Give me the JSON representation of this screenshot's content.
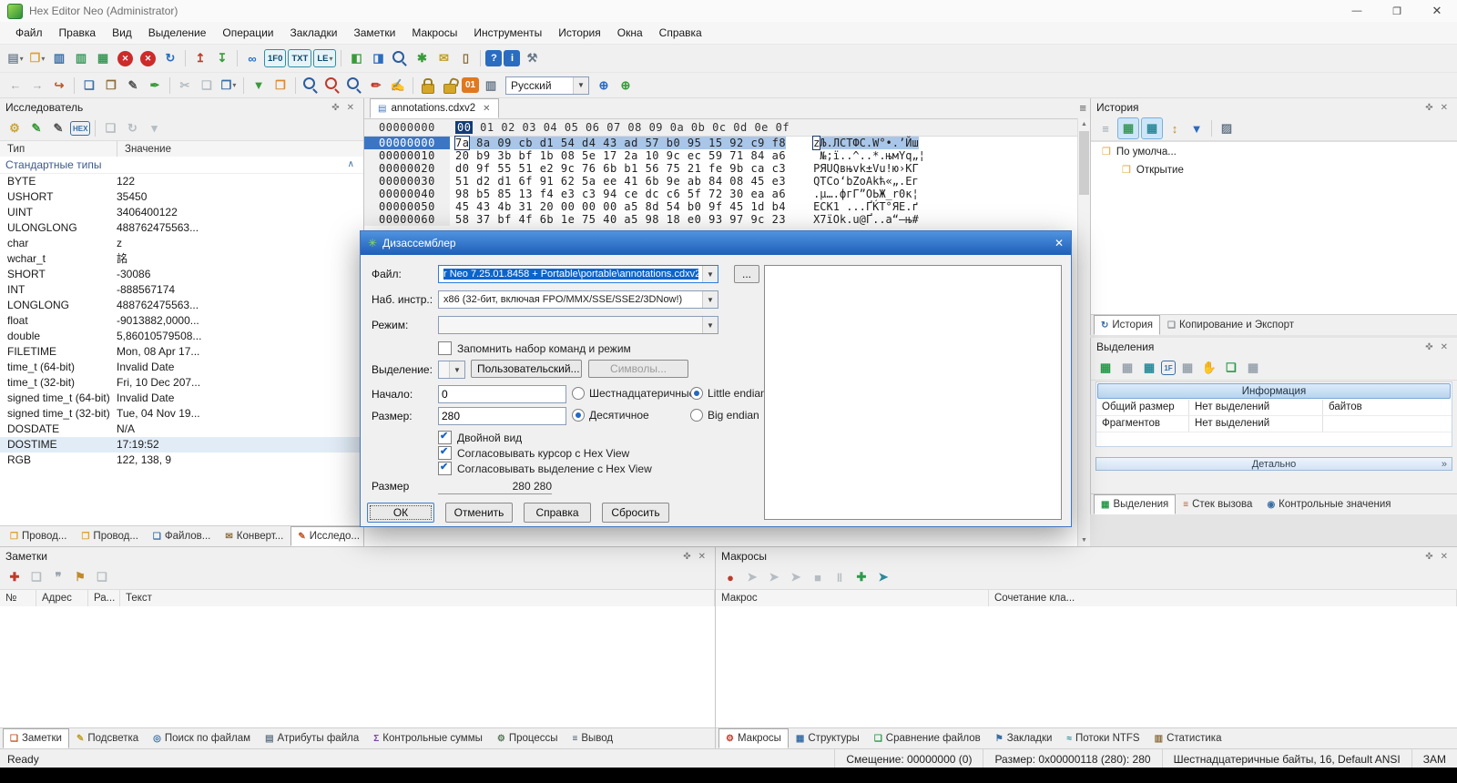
{
  "window": {
    "title": "Hex Editor Neo (Administrator)",
    "controls": {
      "minimize": "—",
      "maximize": "❐",
      "close": "✕"
    }
  },
  "icons": {
    "pin": "✜",
    "close": "✕",
    "hamburger": "≡",
    "collapse": "∧",
    "up_arrow": "▲",
    "down_arrow": "▼",
    "detail_chevron": "»"
  },
  "menubar": {
    "items": [
      "Файл",
      "Правка",
      "Вид",
      "Выделение",
      "Операции",
      "Закладки",
      "Заметки",
      "Макросы",
      "Инструменты",
      "История",
      "Окна",
      "Справка"
    ]
  },
  "toolbar_main": {
    "items": [
      {
        "name": "new-file-icon",
        "glyph": "▤",
        "c": "#7a8896",
        "caret": true
      },
      {
        "name": "open-file-icon",
        "glyph": "❒",
        "c": "#dca42e",
        "caret": true
      },
      {
        "name": "save-icon",
        "glyph": "▥",
        "c": "#3a6ea5"
      },
      {
        "name": "save-as-icon",
        "glyph": "▥",
        "c": "#3a9a5a"
      },
      {
        "name": "save-all-icon",
        "glyph": "▦",
        "c": "#3a9a5a"
      },
      {
        "name": "close-file-icon",
        "glyph": "✕",
        "cls": "ball"
      },
      {
        "name": "close-all-icon",
        "glyph": "✕",
        "cls": "ball"
      },
      {
        "name": "reload-icon",
        "glyph": "↻",
        "c": "#2a6cc0"
      },
      {
        "name": "toolbar-separator",
        "sep": true
      },
      {
        "name": "export-icon",
        "glyph": "↥",
        "c": "#c03a2a"
      },
      {
        "name": "import-icon",
        "glyph": "↧",
        "c": "#3a9a3a"
      },
      {
        "name": "toolbar-separator",
        "sep": true
      },
      {
        "name": "link-document-icon",
        "glyph": "∞",
        "c": "#2a6cc0"
      },
      {
        "name": "offset-display-toggle",
        "glyph": "1F0",
        "cls": "toggle"
      },
      {
        "name": "text-pane-toggle",
        "glyph": "TXT",
        "cls": "toggle"
      },
      {
        "name": "endianness-toggle",
        "glyph": "LE",
        "cls": "toggle",
        "caret": true
      },
      {
        "name": "toolbar-separator",
        "sep": true
      },
      {
        "name": "pattern-select-icon",
        "glyph": "◧",
        "c": "#3a9a3a"
      },
      {
        "name": "pattern-insert-icon",
        "glyph": "◨",
        "c": "#2a6cc0"
      },
      {
        "name": "find-in-file-icon",
        "cls": "magi"
      },
      {
        "name": "operations-icon",
        "glyph": "✱",
        "c": "#3a9a3a"
      },
      {
        "name": "feedback-icon",
        "glyph": "✉",
        "c": "#c0a02a"
      },
      {
        "name": "io-columns-icon",
        "glyph": "▯",
        "c": "#8a6d3b"
      },
      {
        "name": "toolbar-separator",
        "sep": true
      },
      {
        "name": "help-icon",
        "glyph": "?",
        "cls": "badge-blue"
      },
      {
        "name": "info-icon",
        "glyph": "i",
        "cls": "badge-blue"
      },
      {
        "name": "customize-icon",
        "glyph": "⚒",
        "c": "#667788"
      }
    ]
  },
  "toolbar_edit": {
    "language": "Русский",
    "items": [
      {
        "name": "nav-back-icon",
        "glyph": "←",
        "c": "#9aa4ae"
      },
      {
        "name": "nav-forward-icon",
        "glyph": "→",
        "c": "#9aa4ae"
      },
      {
        "name": "goto-offset-icon",
        "glyph": "↪",
        "c": "#c05a2a"
      },
      {
        "name": "toolbar-separator",
        "sep": true
      },
      {
        "name": "copy-icon",
        "glyph": "❏",
        "c": "#3a6ea5"
      },
      {
        "name": "paste-icon",
        "glyph": "❐",
        "c": "#8a6d3b"
      },
      {
        "name": "edit-pencil-icon",
        "glyph": "✎",
        "c": "#555555"
      },
      {
        "name": "fill-icon",
        "glyph": "✒",
        "c": "#3a9a3a"
      },
      {
        "name": "toolbar-separator",
        "sep": true
      },
      {
        "name": "cut-disabled-icon",
        "glyph": "✂",
        "c": "#b5bcc2"
      },
      {
        "name": "copy-disabled-icon",
        "glyph": "❏",
        "c": "#b5bcc2"
      },
      {
        "name": "paste-special-icon",
        "glyph": "❐",
        "c": "#3a6ea5",
        "caret": true
      },
      {
        "name": "toolbar-separator",
        "sep": true
      },
      {
        "name": "modify-data-icon",
        "glyph": "▼",
        "c": "#3a9a3a"
      },
      {
        "name": "structures-box-icon",
        "glyph": "❒",
        "c": "#dc8a2e"
      },
      {
        "name": "toolbar-separator",
        "sep": true
      },
      {
        "name": "zoom-in-icon",
        "cls": "magi"
      },
      {
        "name": "find-replace-icon",
        "cls": "magi magi-red"
      },
      {
        "name": "find-next-icon",
        "cls": "magi"
      },
      {
        "name": "annotate-icon",
        "glyph": "✏",
        "c": "#c03a2a"
      },
      {
        "name": "edit-document-icon",
        "glyph": "✍",
        "c": "#3a6ea5"
      },
      {
        "name": "toolbar-separator",
        "sep": true
      },
      {
        "name": "lock-icon",
        "cls": "locki"
      },
      {
        "name": "unlock-icon",
        "cls": "locki locki-open"
      },
      {
        "name": "binary-display-icon",
        "glyph": "01",
        "cls": "badge-orange"
      },
      {
        "name": "columns-layout-icon",
        "glyph": "▥",
        "c": "#667788"
      }
    ],
    "items2": [
      {
        "name": "encoding-globe-icon",
        "glyph": "⊕",
        "c": "#2a6cc0"
      },
      {
        "name": "codepage-edit-icon",
        "glyph": "⊕",
        "c": "#3a9a3a"
      }
    ]
  },
  "explorer": {
    "title": "Исследователь",
    "toolbar": [
      {
        "name": "type-config-icon",
        "glyph": "⚙",
        "c": "#caa53a"
      },
      {
        "name": "edit-value-icon",
        "glyph": "✎",
        "c": "#3a9a3a"
      },
      {
        "name": "write-value-icon",
        "glyph": "✎",
        "c": "#555555"
      },
      {
        "name": "hex-display-icon",
        "glyph": "HEX",
        "cls": "badge-blue-sm"
      },
      {
        "name": "toolbar-separator",
        "sep": true
      },
      {
        "name": "copy-value-icon",
        "glyph": "❏",
        "c": "#b5bcc2"
      },
      {
        "name": "refresh-values-icon",
        "glyph": "↻",
        "c": "#b5bcc2"
      },
      {
        "name": "explorer-options-icon",
        "glyph": "▾",
        "c": "#b5bcc2"
      }
    ],
    "columns": {
      "type": "Тип",
      "value": "Значение"
    },
    "group": "Стандартные типы",
    "rows": [
      {
        "type": "BYTE",
        "value": "122"
      },
      {
        "type": "USHORT",
        "value": "35450"
      },
      {
        "type": "UINT",
        "value": "3406400122"
      },
      {
        "type": "ULONGLONG",
        "value": "488762475563..."
      },
      {
        "type": "char",
        "value": "z"
      },
      {
        "type": "wchar_t",
        "value": "詺"
      },
      {
        "type": "SHORT",
        "value": "-30086"
      },
      {
        "type": "INT",
        "value": "-888567174"
      },
      {
        "type": "LONGLONG",
        "value": "488762475563..."
      },
      {
        "type": "float",
        "value": "-9013882,0000..."
      },
      {
        "type": "double",
        "value": "5,86010579508..."
      },
      {
        "type": "FILETIME",
        "value": "Mon, 08 Apr 17..."
      },
      {
        "type": "time_t (64-bit)",
        "value": "Invalid Date"
      },
      {
        "type": "time_t (32-bit)",
        "value": "Fri, 10 Dec 207..."
      },
      {
        "type": "signed time_t (64-bit)",
        "value": "Invalid Date"
      },
      {
        "type": "signed time_t (32-bit)",
        "value": "Tue, 04 Nov 19..."
      },
      {
        "type": "DOSDATE",
        "value": "N/A"
      },
      {
        "type": "DOSTIME",
        "value": "17:19:52",
        "selected": true
      },
      {
        "type": "RGB",
        "value": "122, 138, 9"
      }
    ],
    "tabs": [
      {
        "label": "Провод...",
        "glyph": "❒",
        "c": "#dca42e"
      },
      {
        "label": "Провод...",
        "glyph": "❒",
        "c": "#dca42e"
      },
      {
        "label": "Файлов...",
        "glyph": "❏",
        "c": "#3a6ea5"
      },
      {
        "label": "Конверт...",
        "glyph": "✉",
        "c": "#8a6d3b"
      },
      {
        "label": "Исследо...",
        "glyph": "✎",
        "c": "#c05a2a",
        "active": true
      }
    ]
  },
  "hexview": {
    "tab": {
      "label": "annotations.cdxv2",
      "close_glyph": "✕",
      "doc_glyph": "▤"
    },
    "header": {
      "offset": "00000000",
      "h1": "00",
      "h": " 01 02 03 04 05 06 07 08 09 0a 0b 0c 0d 0e 0f"
    },
    "rows": [
      {
        "offset": "00000000",
        "b1": "7a",
        "b": " 8a 09 cb d1 54 d4 43 ad 57 b0 95 15 92 c9 f8",
        "t1": "z",
        "t": "Љ.ЛСTФC.W°•.’Йш",
        "selected": true
      },
      {
        "offset": "00000010",
        "b1": "20",
        "b": " b9 3b bf 1b 08 5e 17 2a 10 9c ec 59 71 84 a6",
        "t1": " ",
        "t": "№;ї..^..*.њмYq„¦"
      },
      {
        "offset": "00000020",
        "b1": "d0",
        "b": " 9f 55 51 e2 9c 76 6b b1 56 75 21 fe 9b ca c3",
        "t1": "Р",
        "t": "ЯUQвњvk±Vu!ю›КГ"
      },
      {
        "offset": "00000030",
        "b1": "51",
        "b": " d2 d1 6f 91 62 5a ee 41 6b 9e ab 84 08 45 e3",
        "t1": "Q",
        "t": "ТСo‘bZоAkћ«„.Eг"
      },
      {
        "offset": "00000040",
        "b1": "98",
        "b": " b5 85 13 f4 e3 c3 94 ce dc c6 5f 72 30 ea a6",
        "t1": ".",
        "t": "µ….фгГ”ОЬЖ_r0к¦"
      },
      {
        "offset": "00000050",
        "b1": "45",
        "b": " 43 4b 31 20 00 00 00 a5 8d 54 b0 9f 45 1d b4",
        "t1": "E",
        "t": "CK1 ...ҐЌT°ЯE.ґ"
      },
      {
        "offset": "00000060",
        "b1": "58",
        "b": " 37 bf 4f 6b 1e 75 40 a5 98 18 e0 93 97 9c 23",
        "t1": "X",
        "t": "7їOk.u@Ґ..а“—њ#"
      }
    ]
  },
  "dialog": {
    "title": "Дизассемблер",
    "title_icon": "✳",
    "close_glyph": "✕",
    "file_label": "Файл:",
    "file_value": "r Neo 7.25.01.8458 + Portable\\portable\\annotations.cdxv2",
    "browse_label": "...",
    "instr_label": "Наб. инстр.:",
    "instr_value": "x86 (32-бит, включая FPO/MMX/SSE/SSE2/3DNow!)",
    "mode_label": "Режим:",
    "remember_label": "Запомнить набор команд и режим",
    "remember": false,
    "selection_label": "Выделение:",
    "custom_button": "Пользовательский...",
    "symbols_button": "Символы...",
    "start_label": "Начало:",
    "start_value": "0",
    "size_label": "Размер:",
    "size_value": "280",
    "radio_hex": "Шестнадцатеричные",
    "radio_dec": "Десятичное",
    "radio_le": "Little endian",
    "radio_be": "Big endian",
    "start_base": "dec",
    "endianness": "little",
    "check_double": "Двойной вид",
    "check_cursor": "Согласовывать курсор с Hex View",
    "check_selection": "Согласовывать выделение с Hex View",
    "double_view": true,
    "sync_cursor": true,
    "sync_selection": true,
    "size2_label": "Размер",
    "size2_value": "280 280",
    "ok": "ОК",
    "cancel": "Отменить",
    "help": "Справка",
    "reset": "Сбросить"
  },
  "history": {
    "title": "История",
    "toolbar": [
      {
        "name": "clear-history-icon",
        "glyph": "≡",
        "c": "#9aa4ae"
      },
      {
        "name": "tree-view-icon",
        "glyph": "▦",
        "c": "#3a9a5a",
        "cls": "pressed"
      },
      {
        "name": "compact-view-icon",
        "glyph": "▦",
        "c": "#2a8a9a",
        "cls": "pressed"
      },
      {
        "name": "sort-history-icon",
        "glyph": "↕",
        "c": "#c08a2a"
      },
      {
        "name": "filter-history-icon",
        "glyph": "▼",
        "c": "#2a6cc0"
      },
      {
        "name": "toolbar-separator",
        "sep": true
      },
      {
        "name": "history-options-icon",
        "glyph": "▨",
        "c": "#667788"
      }
    ],
    "root": "По умолча...",
    "child": "Открытие",
    "root_glyph": "❒",
    "child_glyph": "❒",
    "tabs": [
      {
        "label": "История",
        "glyph": "↻",
        "c": "#3a6ea5",
        "active": true
      },
      {
        "label": "Копирование и Экспорт",
        "glyph": "❏",
        "c": "#8a8f94"
      }
    ]
  },
  "selections": {
    "title": "Выделения",
    "toolbar": [
      {
        "name": "add-selection-icon",
        "glyph": "▦",
        "c": "#2a9a4a"
      },
      {
        "name": "selection-grid-icon",
        "glyph": "▦",
        "c": "#9aa4ae"
      },
      {
        "name": "union-selection-icon",
        "glyph": "▦",
        "c": "#2a8a9a"
      },
      {
        "name": "format-1f-icon",
        "glyph": "1F",
        "cls": "badge-blue-sm"
      },
      {
        "name": "intersect-selection-icon",
        "glyph": "▦",
        "c": "#9aa4ae"
      },
      {
        "name": "hand-tool-icon",
        "glyph": "✋",
        "c": "#dc8a2e"
      },
      {
        "name": "save-selection-icon",
        "glyph": "❏",
        "c": "#2a9a4a"
      },
      {
        "name": "load-selection-icon",
        "glyph": "▦",
        "c": "#9aa4ae"
      }
    ],
    "info_header": "Информация",
    "rows": [
      {
        "label": "Общий размер",
        "value": "Нет выделений",
        "unit": "байтов"
      },
      {
        "label": "Фрагментов",
        "value": "Нет выделений",
        "unit": ""
      }
    ],
    "details": "Детально",
    "tabs": [
      {
        "label": "Выделения",
        "glyph": "▦",
        "c": "#2a9a4a",
        "active": true
      },
      {
        "label": "Стек вызова",
        "glyph": "≡",
        "c": "#c05a2a"
      },
      {
        "label": "Контрольные значения",
        "glyph": "◉",
        "c": "#3a6ea5"
      }
    ]
  },
  "notes": {
    "title": "Заметки",
    "toolbar": [
      {
        "name": "add-note-icon",
        "glyph": "✚",
        "c": "#c03a2a"
      },
      {
        "name": "remove-note-icon",
        "glyph": "❏",
        "c": "#b5bcc2"
      },
      {
        "name": "comments-icon",
        "glyph": "❞",
        "c": "#9aa4ae"
      },
      {
        "name": "flag-note-icon",
        "glyph": "⚑",
        "c": "#c08a2a"
      },
      {
        "name": "export-notes-icon",
        "glyph": "❏",
        "c": "#b5bcc2"
      }
    ],
    "columns": [
      "№",
      "Адрес",
      "Ра...",
      "Текст"
    ],
    "tabs": [
      {
        "label": "Заметки",
        "glyph": "❏",
        "c": "#c05a2a",
        "active": true
      },
      {
        "label": "Подсветка",
        "glyph": "✎",
        "c": "#c0a02a"
      },
      {
        "label": "Поиск по файлам",
        "glyph": "◎",
        "c": "#3a6ea5"
      },
      {
        "label": "Атрибуты файла",
        "glyph": "▤",
        "c": "#667788"
      },
      {
        "label": "Контрольные суммы",
        "glyph": "Σ",
        "c": "#7a44aa"
      },
      {
        "label": "Процессы",
        "glyph": "⚙",
        "c": "#557755"
      },
      {
        "label": "Вывод",
        "glyph": "≡",
        "c": "#445566"
      }
    ]
  },
  "macros": {
    "title": "Макросы",
    "toolbar": [
      {
        "name": "record-macro-icon",
        "glyph": "●",
        "c": "#c0392b"
      },
      {
        "name": "step-into-icon",
        "glyph": "➤",
        "c": "#b5bcc2"
      },
      {
        "name": "step-over-icon",
        "glyph": "➤",
        "c": "#b5bcc2"
      },
      {
        "name": "run-macro-icon",
        "glyph": "➤",
        "c": "#b5bcc2"
      },
      {
        "name": "stop-macro-icon",
        "glyph": "■",
        "c": "#b5bcc2"
      },
      {
        "name": "pause-macro-icon",
        "glyph": "‖",
        "c": "#b5bcc2"
      },
      {
        "name": "add-macro-icon",
        "glyph": "✚",
        "c": "#2a9a4a"
      },
      {
        "name": "play-macro-icon",
        "glyph": "➤",
        "c": "#2a8a9a"
      }
    ],
    "columns": [
      "Макрос",
      "Сочетание кла..."
    ],
    "tabs": [
      {
        "label": "Макросы",
        "glyph": "⚙",
        "c": "#c03a2a",
        "active": true
      },
      {
        "label": "Структуры",
        "glyph": "▦",
        "c": "#3a6ea5"
      },
      {
        "label": "Сравнение файлов",
        "glyph": "❏",
        "c": "#2a9a4a"
      },
      {
        "label": "Закладки",
        "glyph": "⚑",
        "c": "#3a6ea5"
      },
      {
        "label": "Потоки NTFS",
        "glyph": "≈",
        "c": "#2a8a9a"
      },
      {
        "label": "Статистика",
        "glyph": "▥",
        "c": "#8a6d3b"
      }
    ]
  },
  "statusbar": {
    "ready": "Ready",
    "offset": "Смещение: 00000000 (0)",
    "size": "Размер: 0x00000118 (280): 280",
    "encoding": "Шестнадцатеричные байты, 16, Default ANSI",
    "mode": "ЗАМ"
  }
}
